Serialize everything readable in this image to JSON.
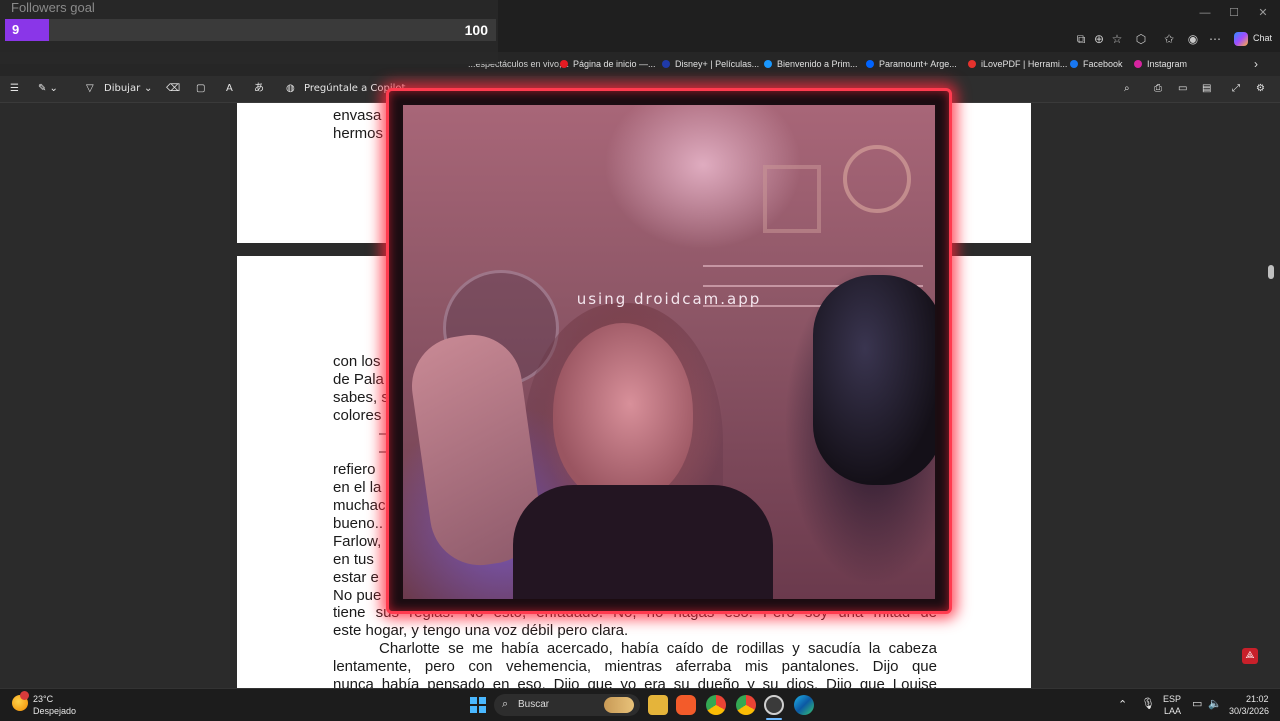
{
  "browser": {
    "window_controls": [
      "—",
      "☐",
      "✕"
    ],
    "chat_label": "Chat",
    "favorites": [
      {
        "label": "Página de inicio —...",
        "color": "#e41b23"
      },
      {
        "label": "Disney+ | Películas...",
        "color": "#1f3aa8"
      },
      {
        "label": "Bienvenido a Prim...",
        "color": "#1a98ff"
      },
      {
        "label": "Paramount+ Arge...",
        "color": "#0064ff"
      },
      {
        "label": "iLovePDF | Herrami...",
        "color": "#e5322d"
      },
      {
        "label": "Facebook",
        "color": "#1877f2"
      },
      {
        "label": "Instagram",
        "color": "#d6249f"
      }
    ],
    "favorites_partial": "...espectáculos en vivo,..."
  },
  "pdf_toolbar": {
    "draw_label": "Dibujar",
    "copilot_label": "Pregúntale a Copilot"
  },
  "document": {
    "page1_lines": [
      "envasa",
      "hermos"
    ],
    "page2_left_lines": [
      "con los",
      "de Pala",
      "sabes, s",
      "colores",
      "—",
      "—",
      "refiero",
      "en el la",
      "muchac",
      "bueno..",
      "Farlow,",
      "en tus",
      "estar e",
      "No pue"
    ],
    "page2_full_lines": [
      "tiene sus reglas. No esto, enfadado. No, no hagas eso. Pero soy una mitad de",
      "este hogar, y tengo una voz débil pero clara.",
      "Charlotte se me había acercado, había caído de rodillas y sacudía la cabeza",
      "lentamente, pero con vehemencia, mientras aferraba mis pantalones. Dijo que",
      "nunca había pensado en eso. Dijo que yo era su dueño y su dios. Dijo que Louise"
    ]
  },
  "followers_goal": {
    "title": "Followers goal",
    "current": "9",
    "max": "100",
    "progress": 0.09,
    "color": "#8a36e8"
  },
  "webcam": {
    "watermark": "using droidcam.app",
    "border_color": "#ff3b4f"
  },
  "taskbar": {
    "weather_temp": "23°C",
    "weather_desc": "Despejado",
    "search_placeholder": "Buscar",
    "lang_top": "ESP",
    "lang_bottom": "LAA",
    "time": "21:02",
    "date": "30/3/2026"
  }
}
